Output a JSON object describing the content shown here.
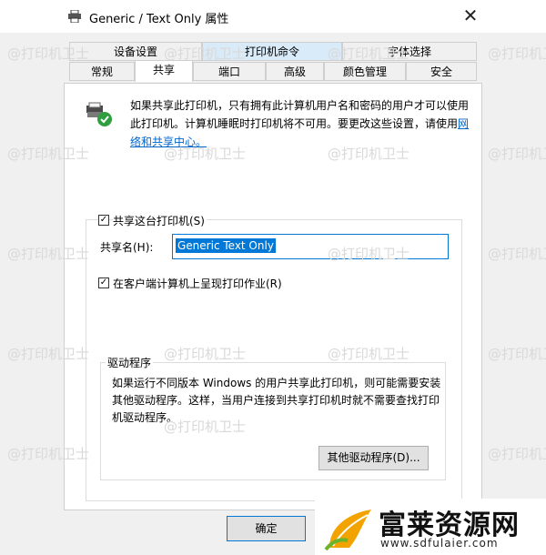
{
  "title": "Generic / Text Only 属性",
  "tabs_row1": [
    "设备设置",
    "打印机命令",
    "字体选择"
  ],
  "tabs_row2": [
    "常规",
    "共享",
    "端口",
    "高级",
    "颜色管理",
    "安全"
  ],
  "intro_text": "如果共享此打印机，只有拥有此计算机用户名和密码的用户才可以使用此打印机。计算机睡眠时打印机将不可用。要更改这些设置，请使用",
  "intro_link": "网络和共享中心。",
  "share_checkbox_label": "共享这台打印机(S)",
  "share_name_label": "共享名(H):",
  "share_name_value": "Generic  Text Only",
  "render_checkbox_label": "在客户端计算机上呈现打印作业(R)",
  "driver_group_title": "驱动程序",
  "driver_text": "如果运行不同版本 Windows 的用户共享此打印机，则可能需要安装其他驱动程序。这样，当用户连接到共享打印机时就不需要查找打印机驱动程序。",
  "other_drivers_button": "其他驱动程序(D)...",
  "ok_button": "确定",
  "watermark_text": "@打印机卫士",
  "brand_name": "富莱资源网",
  "brand_url": "www.sdfulaier.com",
  "colors": {
    "accent": "#0078d7",
    "link": "#0066cc",
    "selected_tab": "#d9eaf8"
  }
}
